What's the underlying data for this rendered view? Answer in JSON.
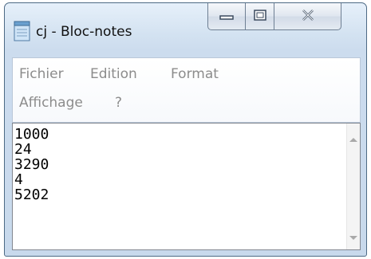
{
  "window": {
    "title": "cj - Bloc-notes",
    "icon": "notepad-icon",
    "buttons": {
      "minimize": "minimize-icon",
      "maximize": "maximize-icon",
      "close": "close-icon"
    }
  },
  "menubar": {
    "row1": [
      "Fichier",
      "Edition",
      "Format"
    ],
    "row2": [
      "Affichage",
      "?"
    ]
  },
  "editor": {
    "lines": [
      "1000",
      "24",
      "3290",
      "4",
      "5202"
    ]
  },
  "colors": {
    "frame": "#ccdcee",
    "menu_text_disabled": "#8c8c8c"
  }
}
